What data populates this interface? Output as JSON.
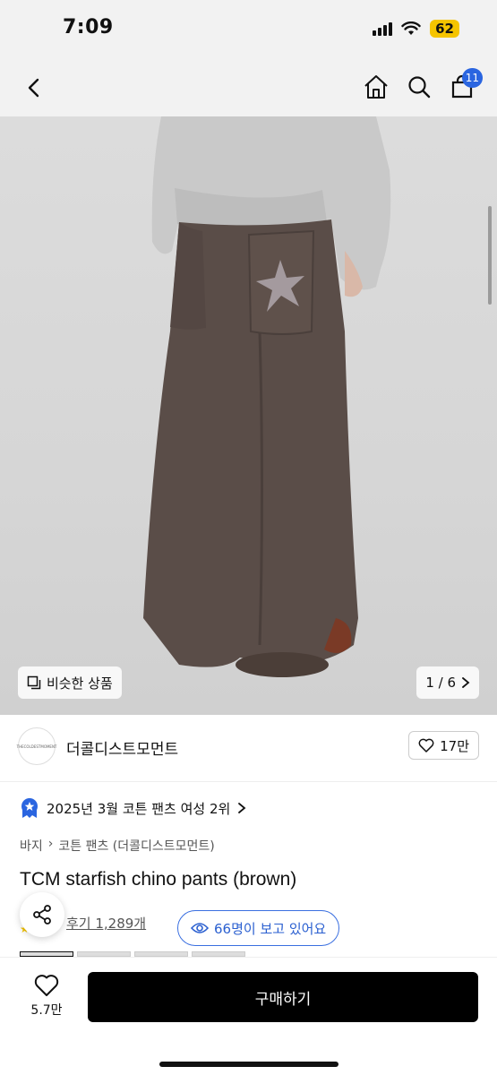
{
  "status": {
    "time": "7:09",
    "battery": "62"
  },
  "nav": {
    "cart_count": "11"
  },
  "image": {
    "similar_label": "비슷한 상품",
    "pager": "1 / 6"
  },
  "brand": {
    "name": "더콜디스트모먼트",
    "logo_text": "THECOLDESTMOMENT",
    "likes": "17만"
  },
  "ranking": {
    "text": "2025년 3월 코튼 팬츠 여성 2위"
  },
  "breadcrumb": {
    "items": [
      "바지",
      "코튼 팬츠 (더콜디스트모먼트)"
    ]
  },
  "product": {
    "title": "TCM starfish chino pants (brown)"
  },
  "reviews": {
    "link": "후기 1,289개"
  },
  "viewers": {
    "text": "66명이 보고 있어요"
  },
  "bottom": {
    "wish_count": "5.7만",
    "buy_label": "구매하기"
  },
  "colors": {
    "accent": "#2a65e0",
    "pants": "#5a4d48",
    "buy_button": "#000000"
  }
}
